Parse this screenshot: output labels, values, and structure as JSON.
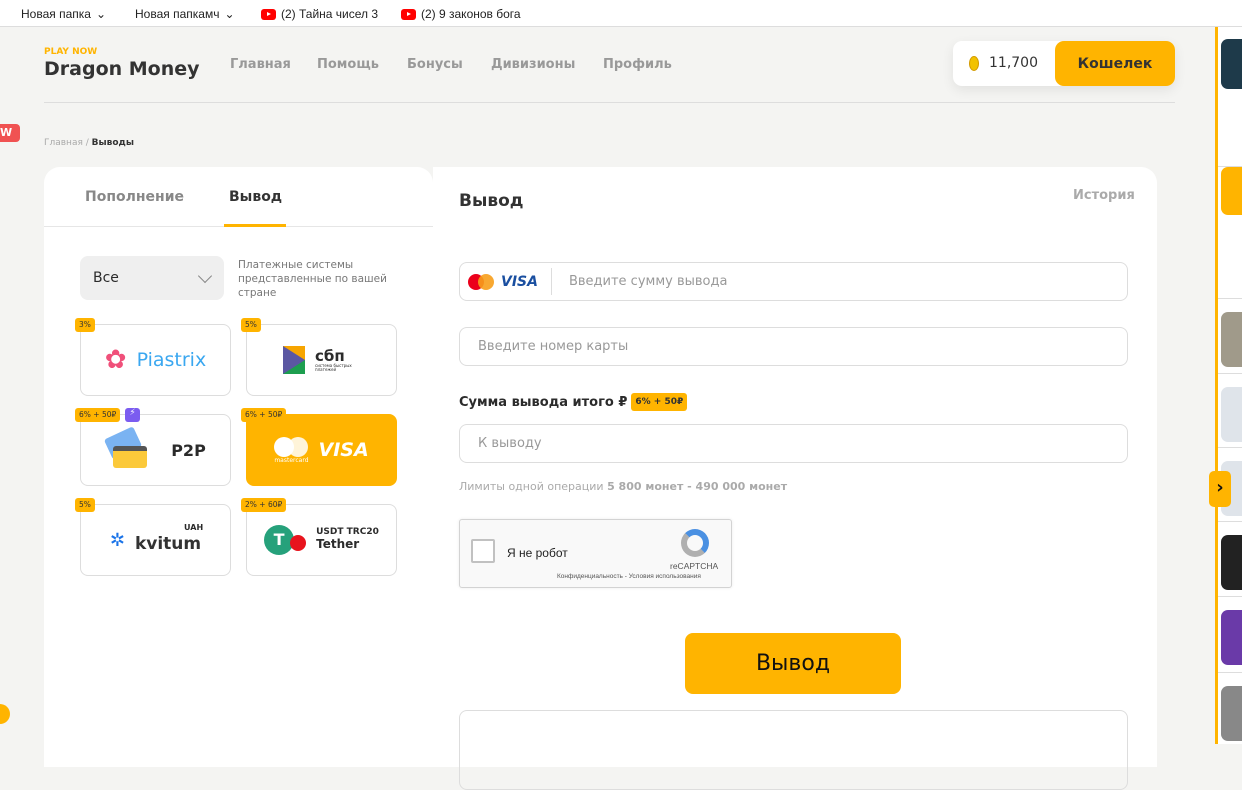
{
  "bookmarks": [
    {
      "label": "Новая папка",
      "type": "folder"
    },
    {
      "label": "Новая папкамч",
      "type": "folder"
    },
    {
      "label": "(2) Тайна чисел 3",
      "type": "youtube"
    },
    {
      "label": "(2) 9 законов бога",
      "type": "youtube"
    }
  ],
  "header": {
    "tagline": "PLAY NOW",
    "logo": "Dragon Money",
    "nav": [
      "Главная",
      "Помощь",
      "Бонусы",
      "Дивизионы",
      "Профиль"
    ],
    "balance": "11,700",
    "wallet_label": "Кошелек"
  },
  "badge_new": "W",
  "breadcrumb": {
    "home": "Главная",
    "sep": "/",
    "current": "Выводы"
  },
  "left": {
    "tabs": [
      "Пополнение",
      "Вывод"
    ],
    "active_tab": 1,
    "filter_value": "Все",
    "filter_note": "Платежные системы представленные по вашей стране",
    "methods": [
      {
        "name": "Piastrix",
        "fee": "3%"
      },
      {
        "name": "сбп",
        "sub": "система быстрых платежей",
        "fee": "5%"
      },
      {
        "name": "P2P",
        "fee": "6% + 50₽",
        "flash": true
      },
      {
        "name": "VISA",
        "brand": "mastercard",
        "fee": "6% + 50₽",
        "active": true
      },
      {
        "name": "kvitum",
        "sub": "UAH",
        "fee": "5%"
      },
      {
        "name": "Tether",
        "sub": "USDT TRC20",
        "fee": "2% + 60₽"
      }
    ]
  },
  "right": {
    "title": "Вывод",
    "history": "История",
    "amount_placeholder": "Введите сумму вывода",
    "card_placeholder": "Введите номер карты",
    "total_label": "Сумма вывода итого ₽",
    "total_fee": "6% + 50₽",
    "payout_placeholder": "К выводу",
    "limits_prefix": "Лимиты одной операции",
    "limits_value": "5 800 монет - 490 000 монет",
    "captcha": {
      "label": "Я не робот",
      "brand": "reCAPTCHA",
      "links": "Конфиденциальность - Условия использования"
    },
    "submit": "Вывод",
    "card_brands": {
      "mc": "mastercard",
      "visa": "VISA"
    }
  },
  "colors": {
    "accent": "#ffb400",
    "bg": "#f4f4f2"
  }
}
